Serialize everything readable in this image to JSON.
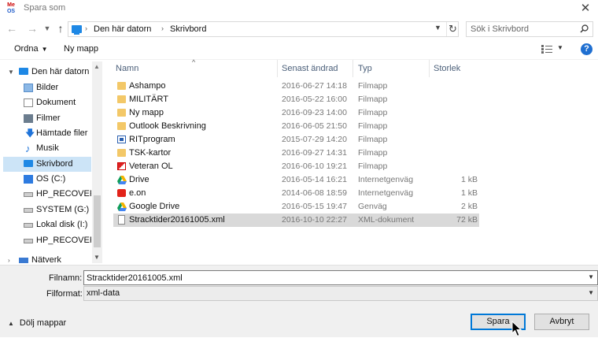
{
  "window": {
    "title": "Spara som",
    "app_icon_text_top": "Me",
    "app_icon_text_bottom": "OS"
  },
  "address_bar": {
    "icon": "computer-icon",
    "crumbs": [
      "Den här datorn",
      "Skrivbord"
    ]
  },
  "search": {
    "placeholder": "Sök i Skrivbord"
  },
  "toolbar": {
    "organize_label": "Ordna",
    "new_folder_label": "Ny mapp",
    "help_label": "?"
  },
  "nav_pane": {
    "items": [
      {
        "label": "Den här datorn",
        "icon": "computer-icon"
      },
      {
        "label": "Bilder",
        "icon": "pictures-icon"
      },
      {
        "label": "Dokument",
        "icon": "documents-icon"
      },
      {
        "label": "Filmer",
        "icon": "videos-icon"
      },
      {
        "label": "Hämtade filer",
        "icon": "download-icon"
      },
      {
        "label": "Musik",
        "icon": "music-icon"
      },
      {
        "label": "Skrivbord",
        "icon": "desktop-icon",
        "selected": true
      },
      {
        "label": "OS (C:)",
        "icon": "os-drive-icon"
      },
      {
        "label": "HP_RECOVERY (",
        "icon": "drive-icon"
      },
      {
        "label": "SYSTEM (G:)",
        "icon": "drive-icon"
      },
      {
        "label": "Lokal disk (I:)",
        "icon": "drive-icon"
      },
      {
        "label": "HP_RECOVERY (",
        "icon": "drive-icon"
      },
      {
        "label": "Nätverk",
        "icon": "network-icon"
      }
    ]
  },
  "file_list": {
    "columns": [
      "Namn",
      "Senast ändrad",
      "Typ",
      "Storlek"
    ],
    "rows": [
      {
        "name": "Ashampo",
        "date": "2016-06-27 14:18",
        "type": "Filmapp",
        "size": "",
        "icon": "folder-icon"
      },
      {
        "name": "MILITÄRT",
        "date": "2016-05-22 16:00",
        "type": "Filmapp",
        "size": "",
        "icon": "folder-icon"
      },
      {
        "name": "Ny mapp",
        "date": "2016-09-23 14:00",
        "type": "Filmapp",
        "size": "",
        "icon": "folder-icon"
      },
      {
        "name": "Outlook Beskrivning",
        "date": "2016-06-05 21:50",
        "type": "Filmapp",
        "size": "",
        "icon": "folder-icon"
      },
      {
        "name": "RITprogram",
        "date": "2015-07-29 14:20",
        "type": "Filmapp",
        "size": "",
        "icon": "rit-folder-icon"
      },
      {
        "name": "TSK-kartor",
        "date": "2016-09-27 14:31",
        "type": "Filmapp",
        "size": "",
        "icon": "folder-icon"
      },
      {
        "name": "Veteran OL",
        "date": "2016-06-10 19:21",
        "type": "Filmapp",
        "size": "",
        "icon": "veteran-folder-icon"
      },
      {
        "name": "Drive",
        "date": "2016-05-14 16:21",
        "type": "Internetgenväg",
        "size": "1 kB",
        "icon": "google-drive-icon"
      },
      {
        "name": "e.on",
        "date": "2014-06-08 18:59",
        "type": "Internetgenväg",
        "size": "1 kB",
        "icon": "eon-icon"
      },
      {
        "name": "Google Drive",
        "date": "2016-05-15 19:47",
        "type": "Genväg",
        "size": "2 kB",
        "icon": "google-drive-icon"
      },
      {
        "name": "Stracktider20161005.xml",
        "date": "2016-10-10 22:27",
        "type": "XML-dokument",
        "size": "72 kB",
        "icon": "xml-file-icon",
        "selected": true
      }
    ]
  },
  "save_form": {
    "filename_label": "Filnamn:",
    "filename_value": "Stracktider20161005.xml",
    "filetype_label": "Filformat:",
    "filetype_value": "xml-data"
  },
  "footer": {
    "hide_folders_label": "Dölj mappar",
    "save_label": "Spara",
    "cancel_label": "Avbryt"
  },
  "colors": {
    "accent": "#0078d7",
    "selection": "#cce4f7",
    "row_selected": "#d9d9d9",
    "folder": "#f3c868"
  }
}
